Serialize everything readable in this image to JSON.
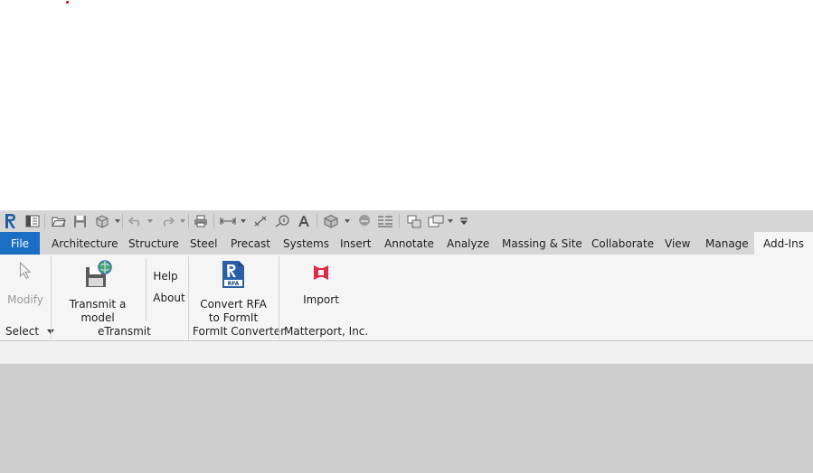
{
  "app": {
    "name": "Revit"
  },
  "tabs": [
    {
      "label": "File"
    },
    {
      "label": "Architecture"
    },
    {
      "label": "Structure"
    },
    {
      "label": "Steel"
    },
    {
      "label": "Precast"
    },
    {
      "label": "Systems"
    },
    {
      "label": "Insert"
    },
    {
      "label": "Annotate"
    },
    {
      "label": "Analyze"
    },
    {
      "label": "Massing & Site"
    },
    {
      "label": "Collaborate"
    },
    {
      "label": "View"
    },
    {
      "label": "Manage"
    },
    {
      "label": "Add-Ins"
    }
  ],
  "active_tab": "Add-Ins",
  "ribbon": {
    "modify_label": "Modify",
    "transmit_label": "Transmit a model",
    "help_label": "Help",
    "about_label": "About",
    "convert_label_1": "Convert RFA",
    "convert_label_2": "to FormIt",
    "import_label": "Import",
    "panels": {
      "select": "Select",
      "etransmit": "eTransmit",
      "formit": "FormIt Converter",
      "matterport": "Matterport, Inc."
    }
  },
  "icons": {
    "app_logo": "revit-logo-icon",
    "rfa_badge": "RFA"
  },
  "colors": {
    "file_tab": "#1a6fc4",
    "active_tab_bg": "#f5f5f5",
    "ribbon_bg": "#f5f5f5",
    "qat_bg": "#d6d6d6",
    "canvas_bg": "#cdcdcd",
    "matterport_red": "#e0284a"
  }
}
